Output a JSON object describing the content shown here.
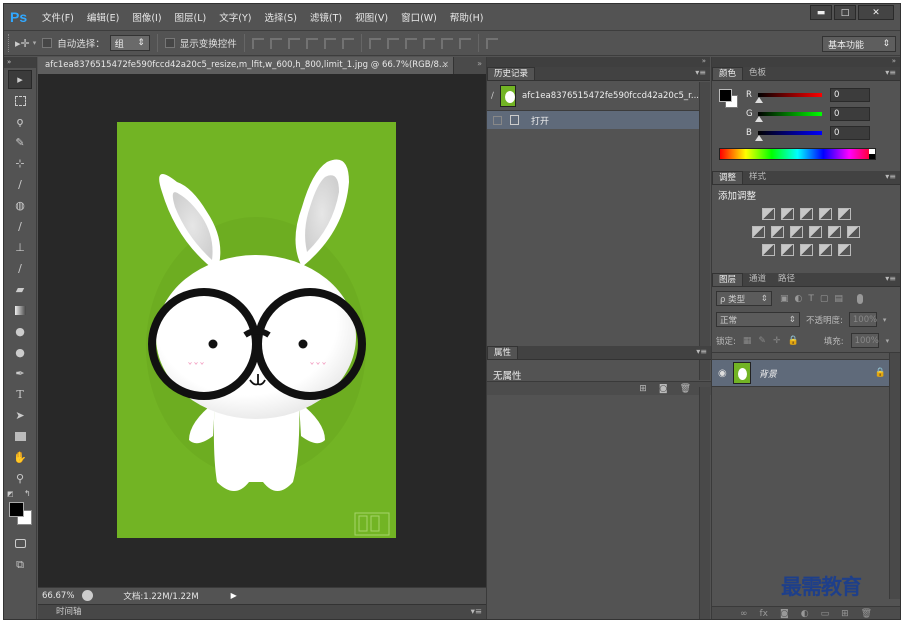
{
  "app": {
    "logo": "Ps"
  },
  "menu": [
    "文件(F)",
    "编辑(E)",
    "图像(I)",
    "图层(L)",
    "文字(Y)",
    "选择(S)",
    "滤镜(T)",
    "视图(V)",
    "窗口(W)",
    "帮助(H)"
  ],
  "window_buttons": [
    "▬",
    "□",
    "✕"
  ],
  "options": {
    "auto_select_label": "自动选择：",
    "auto_select_value": "组",
    "show_transform_label": "显示变换控件",
    "workspace": "基本功能"
  },
  "document": {
    "tab_title": "afc1ea8376515472fe590fccd42a20c5_resize,m_lfit,w_600,h_800,limit_1.jpg @ 66.7%(RGB/8...",
    "close": "×",
    "zoom": "66.67%",
    "doc_size": "文档:1.22M/1.22M",
    "timeline": "时间轴"
  },
  "history": {
    "tab": "历史记录",
    "snapshot_name": "afc1ea8376515472fe590fccd42a20c5_r...",
    "items": [
      "打开"
    ]
  },
  "properties": {
    "tab": "属性",
    "body": "无属性"
  },
  "color": {
    "tabs": [
      "颜色",
      "色板"
    ],
    "r": "0",
    "g": "0",
    "b": "0",
    "r_label": "R",
    "g_label": "G",
    "b_label": "B"
  },
  "adjustments": {
    "tabs": [
      "调整",
      "样式"
    ],
    "title": "添加调整"
  },
  "layers": {
    "tabs": [
      "图层",
      "通道",
      "路径"
    ],
    "filter_kind": "ρ 类型",
    "blend_mode": "正常",
    "opacity_label": "不透明度:",
    "opacity_value": "100%",
    "lock_label": "锁定:",
    "fill_label": "填充:",
    "fill_value": "100%",
    "layer_name": "背景"
  },
  "watermark": "最需教育",
  "colors": {
    "artboard": "#72b424",
    "ps_blue": "#31a8ff",
    "selected_row": "#5f6a7a"
  }
}
